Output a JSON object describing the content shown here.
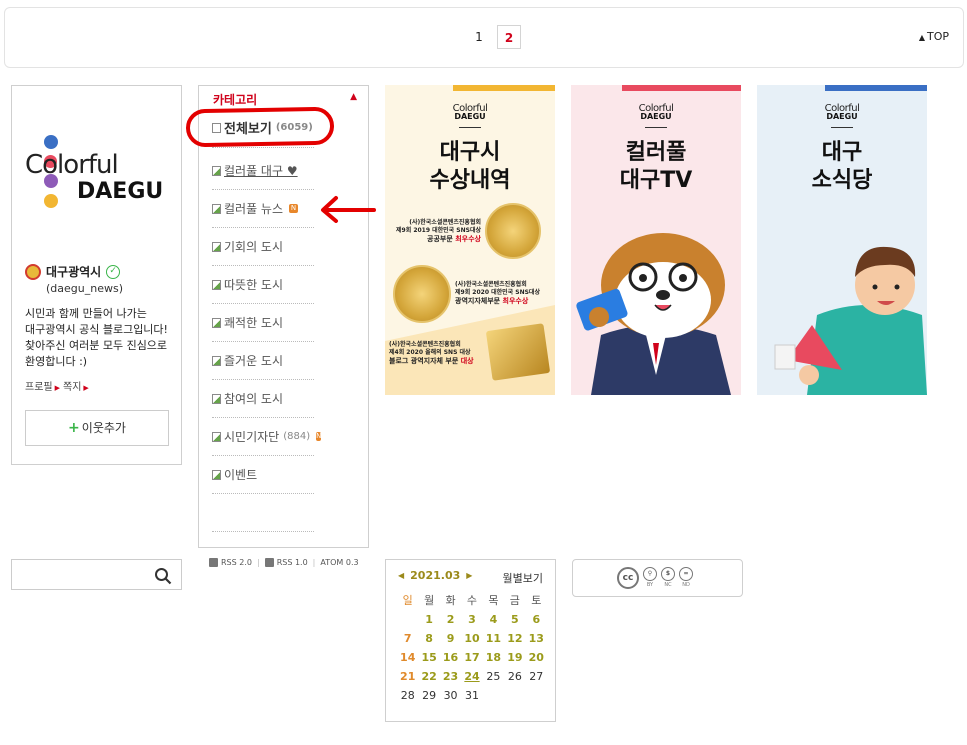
{
  "pagination": {
    "pages": [
      "1",
      "2"
    ],
    "current": "2",
    "top_label": "TOP"
  },
  "profile": {
    "logo_word1": "Colorful",
    "logo_word2": "DAEGU",
    "name": "대구광역시",
    "id": "(daegu_news)",
    "intro": "시민과 함께 만들어 나가는 대구광역시 공식 블로그입니다! 찾아주신 여러분 모두 진심으로 환영합니다 :)",
    "link_profile": "프로필",
    "link_note": "쪽지",
    "add_neighbor": "이웃추가"
  },
  "category": {
    "title": "카테고리",
    "all": {
      "label": "전체보기",
      "count": "(6059)"
    },
    "items": [
      {
        "label": "컬러풀 대구 ♥",
        "count": ""
      },
      {
        "label": "컬러풀 뉴스",
        "count": "",
        "new": "N"
      },
      {
        "label": "기회의 도시",
        "count": ""
      },
      {
        "label": "따뜻한 도시",
        "count": ""
      },
      {
        "label": "쾌적한 도시",
        "count": ""
      },
      {
        "label": "즐거운 도시",
        "count": ""
      },
      {
        "label": "참여의 도시",
        "count": ""
      },
      {
        "label": "시민기자단",
        "count": "(884)",
        "new": "N"
      },
      {
        "label": "이벤트",
        "count": ""
      }
    ]
  },
  "rss": {
    "rss2": "RSS 2.0",
    "rss1": "RSS 1.0",
    "atom": "ATOM 0.3"
  },
  "banners": [
    {
      "logo_c": "Colorful",
      "logo_d": "DAEGU",
      "title_l1": "대구시",
      "title_l2": "수상내역",
      "award1_l1": "(사)한국소셜콘텐츠진흥협회",
      "award1_l2": "제9회 2019 대한민국 SNS대상",
      "award1_l3": "공공부문",
      "award1_l3b": "최우수상",
      "award2_l1": "(사)한국소셜콘텐츠진흥협회",
      "award2_l2": "제9회 2020 대한민국 SNS대상",
      "award2_l3": "광역지자체부문",
      "award2_l3b": "최우수상",
      "award3_l1": "(사)한국소셜콘텐츠진흥협회",
      "award3_l2": "제4회 2020 올해의 SNS 대상",
      "award3_l3": "블로그 광역지자체 부문",
      "award3_l3b": "대상",
      "bar_color": "#f2b632"
    },
    {
      "logo_c": "Colorful",
      "logo_d": "DAEGU",
      "title_l1": "컬러풀",
      "title_l2": "대구TV",
      "bar_color": "#e84a5f"
    },
    {
      "logo_c": "Colorful",
      "logo_d": "DAEGU",
      "title_l1": "대구",
      "title_l2": "소식당",
      "bar_color": "#3a6fc4"
    }
  ],
  "calendar": {
    "month_label": "2021.03",
    "month_view": "월별보기",
    "weekdays": [
      "일",
      "월",
      "화",
      "수",
      "목",
      "금",
      "토"
    ],
    "days": [
      "",
      "1",
      "2",
      "3",
      "4",
      "5",
      "6",
      "7",
      "8",
      "9",
      "10",
      "11",
      "12",
      "13",
      "14",
      "15",
      "16",
      "17",
      "18",
      "19",
      "20",
      "21",
      "22",
      "23",
      "24",
      "25",
      "26",
      "27",
      "28",
      "29",
      "30",
      "31"
    ],
    "posted_until": 24,
    "today": "24"
  },
  "cc": {
    "main": "cc",
    "by": "BY",
    "nc": "NC",
    "nd": "ND"
  },
  "colors": {
    "accent_red": "#d0021b",
    "annotation": "#e30000",
    "calendar_post": "#9b9b1b",
    "sunday": "#e08a2c"
  }
}
